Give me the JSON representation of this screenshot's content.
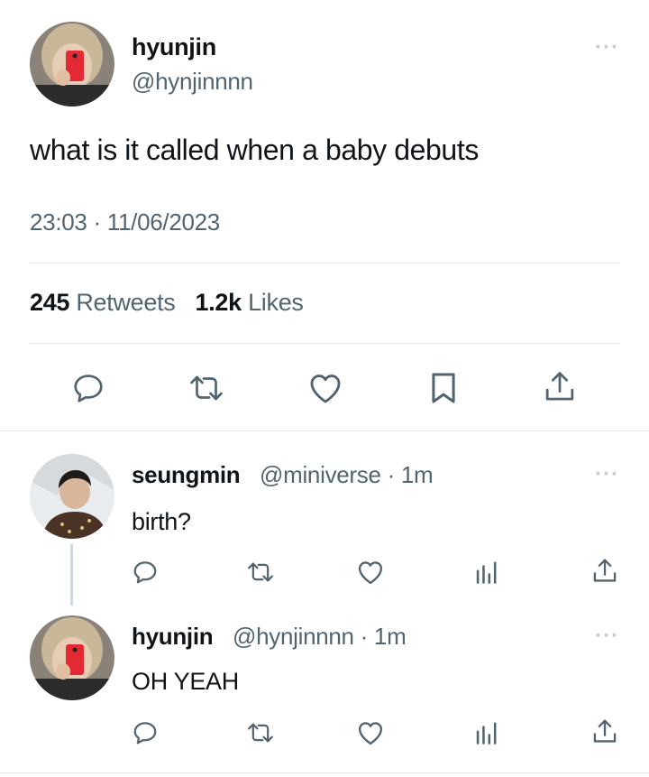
{
  "main_tweet": {
    "author_name": "hyunjin",
    "author_handle": "@hynjinnnn",
    "text": "what is it called when a baby debuts",
    "timestamp": "23:03 · 11/06/2023",
    "retweets_count": "245",
    "retweets_label": "Retweets",
    "likes_count": "1.2k",
    "likes_label": "Likes",
    "more_glyph": "···"
  },
  "replies": [
    {
      "author_name": "seungmin",
      "author_handle": "@miniverse · 1m",
      "text": "birth?",
      "more_glyph": "···"
    },
    {
      "author_name": "hyunjin",
      "author_handle": "@hynjinnnn · 1m",
      "text": "OH YEAH",
      "more_glyph": "···"
    }
  ],
  "icons": {
    "main_actions": [
      "reply-icon",
      "retweet-icon",
      "like-icon",
      "bookmark-icon",
      "share-icon"
    ],
    "reply_actions": [
      "reply-icon",
      "retweet-icon",
      "like-icon",
      "analytics-icon",
      "share-icon"
    ]
  },
  "colors": {
    "text_primary": "#0f1419",
    "text_secondary": "#536471",
    "icon": "#536471",
    "divider": "#e3e8eb"
  }
}
